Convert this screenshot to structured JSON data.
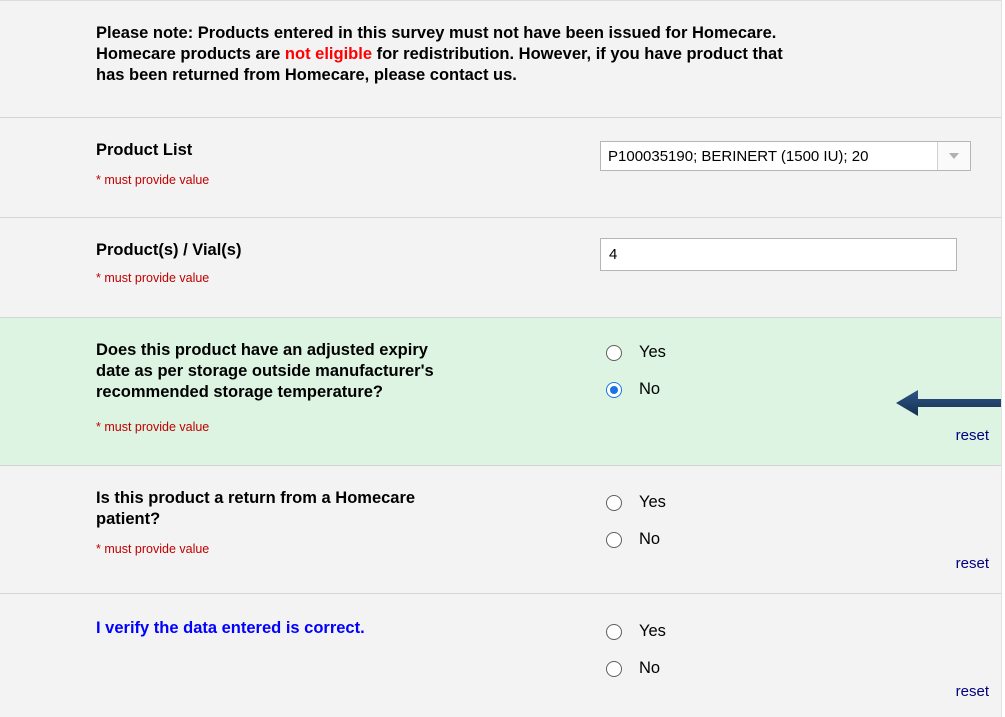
{
  "notice": {
    "line1": "Please note: Products entered in this survey must not have been issued for Homecare.",
    "line2_before": "Homecare products are ",
    "line2_highlight": "not eligible",
    "line2_after": " for redistribution. However, if you have product that",
    "line3": "has been returned from Homecare, please contact us."
  },
  "product_list": {
    "label": "Product List",
    "required": "* must provide value",
    "selected_value": "P100035190; BERINERT (1500 IU); 20"
  },
  "vials": {
    "label": "Product(s) / Vial(s)",
    "required": "* must provide value",
    "value": "4"
  },
  "adjusted_expiry": {
    "label_line1": "Does this product have an adjusted expiry",
    "label_line2": "date as per storage outside manufacturer's",
    "label_line3": "recommended storage temperature?",
    "required": "* must provide value",
    "yes": "Yes",
    "no": "No",
    "selected": "No",
    "reset": "reset"
  },
  "homecare_return": {
    "label_line1": "Is this product a return from a Homecare",
    "label_line2": "patient?",
    "required": "* must provide value",
    "yes": "Yes",
    "no": "No",
    "reset": "reset"
  },
  "verify": {
    "label": "I verify the data entered is correct.",
    "yes": "Yes",
    "no": "No",
    "reset": "reset"
  },
  "colors": {
    "highlight_row": "#dcf4e1",
    "required_text": "#c00000",
    "verify_label": "#0000ff",
    "arrow": "#1f3f66"
  },
  "annotation": {
    "icon": "left-arrow-icon"
  }
}
